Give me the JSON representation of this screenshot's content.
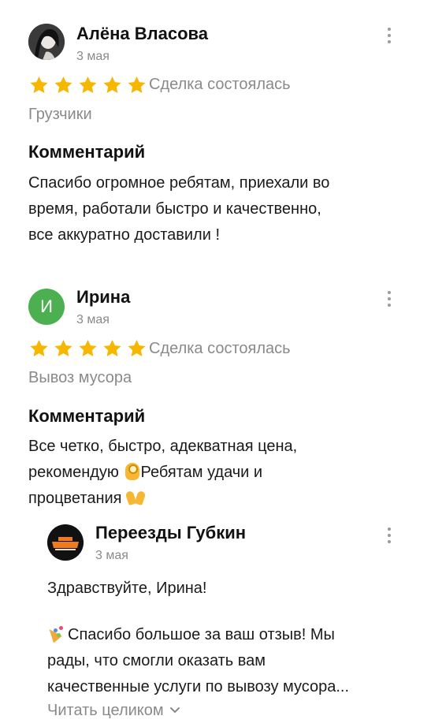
{
  "reviews": [
    {
      "author": "Алёна Власова",
      "date": "3 мая",
      "rating": 5,
      "status": "Сделка состоялась",
      "service": "Грузчики",
      "comment_heading": "Комментарий",
      "comment_lines": [
        "Спасибо огромное ребятам, приехали во",
        "время, работали быстро и качественно,",
        "все аккуратно доставили !"
      ]
    },
    {
      "author": "Ирина",
      "avatar_letter": "И",
      "avatar_color": "#4caf50",
      "date": "3 мая",
      "rating": 5,
      "status": "Сделка состоялась",
      "service": "Вывоз мусора",
      "comment_heading": "Комментарий",
      "comment_lines": [
        "Все четко, быстро, адекватная цена,",
        "рекомендую",
        "Ребятам удачи и",
        "процветания"
      ],
      "reply": {
        "author": "Переезды Губкин",
        "date": "3 мая",
        "greeting": "Здравствуйте, Ирина!",
        "lines": [
          "Спасибо большое за ваш отзыв! Мы",
          "рады, что смогли оказать вам",
          "качественные услуги по вывозу мусора..."
        ],
        "read_more": "Читать целиком"
      }
    }
  ],
  "colors": {
    "star": "#f6b700",
    "muted": "#8a8a8a"
  }
}
